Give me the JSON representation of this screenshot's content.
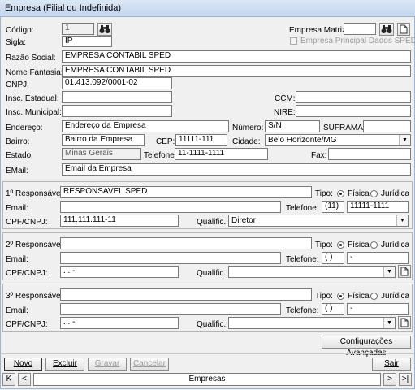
{
  "window_title": "Empresa (Filial ou Indefinida)",
  "main": {
    "codigo_label": "Código:",
    "codigo_value": "1",
    "empresa_matriz_label": "Empresa Matriz:",
    "empresa_matriz_value": "",
    "empresa_principal_label": "Empresa Principal Dados SPED",
    "sigla_label": "Sigla:",
    "sigla_value": "IP",
    "razao_social_label": "Razão Social:",
    "razao_social_value": "EMPRESA CONTABIL SPED",
    "nome_fantasia_label": "Nome Fantasia:",
    "nome_fantasia_value": "EMPRESA CONTABIL SPED",
    "cnpj_label": "CNPJ:",
    "cnpj_value": "01.413.092/0001-02",
    "insc_estadual_label": "Insc. Estadual:",
    "insc_estadual_value": "",
    "ccm_label": "CCM:",
    "ccm_value": "",
    "insc_municipal_label": "Insc. Municipal:",
    "insc_municipal_value": "",
    "nire_label": "NIRE:",
    "nire_value": "",
    "endereco_label": "Endereço:",
    "endereco_value": "Endereço da Empresa",
    "numero_label": "Número:",
    "numero_value": "S/N",
    "suframa_label": "SUFRAMA:",
    "suframa_value": "",
    "bairro_label": "Bairro:",
    "bairro_value": "Bairro da Empresa",
    "cep_label": "CEP:",
    "cep_value": "11111-111",
    "cidade_label": "Cidade:",
    "cidade_value": "Belo Horizonte/MG",
    "estado_label": "Estado:",
    "estado_value": "Minas Gerais",
    "telefone_label": "Telefone:",
    "telefone_value": "11-1111-1111",
    "fax_label": "Fax:",
    "fax_value": "",
    "email_label": "EMail:",
    "email_value": "Email da Empresa"
  },
  "responsaveis": [
    {
      "resp_label": "1º Responsável:",
      "resp_value": "RESPONSAVEL SPED",
      "tipo_label": "Tipo:",
      "fisica_label": "Física",
      "juridica_label": "Jurídica",
      "email_label": "Email:",
      "email_value": "",
      "telefone_label": "Telefone:",
      "ddd_value": "(11)",
      "telefone_value": "11111-1111",
      "cpf_label": "CPF/CNPJ:",
      "cpf_value": "111.111.111-11",
      "qualific_label": "Qualific.:",
      "qualific_value": "Diretor"
    },
    {
      "resp_label": "2º Responsável:",
      "resp_value": "",
      "tipo_label": "Tipo:",
      "fisica_label": "Física",
      "juridica_label": "Jurídica",
      "email_label": "Email:",
      "email_value": "",
      "telefone_label": "Telefone:",
      "ddd_value": "( )",
      "telefone_value": "-",
      "cpf_label": "CPF/CNPJ:",
      "cpf_value": ". . -",
      "qualific_label": "Qualific.:",
      "qualific_value": ""
    },
    {
      "resp_label": "3º Responsável:",
      "resp_value": "",
      "tipo_label": "Tipo:",
      "fisica_label": "Física",
      "juridica_label": "Jurídica",
      "email_label": "Email:",
      "email_value": "",
      "telefone_label": "Telefone:",
      "ddd_value": "( )",
      "telefone_value": "-",
      "cpf_label": "CPF/CNPJ:",
      "cpf_value": ". . -",
      "qualific_label": "Qualific.:",
      "qualific_value": ""
    }
  ],
  "config_button": "Configurações Avançadas",
  "toolbar": {
    "novo": "Novo",
    "excluir": "Excluir",
    "gravar": "Gravar",
    "cancelar": "Cancelar",
    "sair": "Sair"
  },
  "nav": {
    "first": "K",
    "prev": "<",
    "label": "Empresas",
    "next": ">",
    "last": ">|"
  },
  "icons": {
    "search": "binoculars-icon",
    "new_record": "new-document-icon",
    "dropdown": "chevron-down-icon"
  }
}
